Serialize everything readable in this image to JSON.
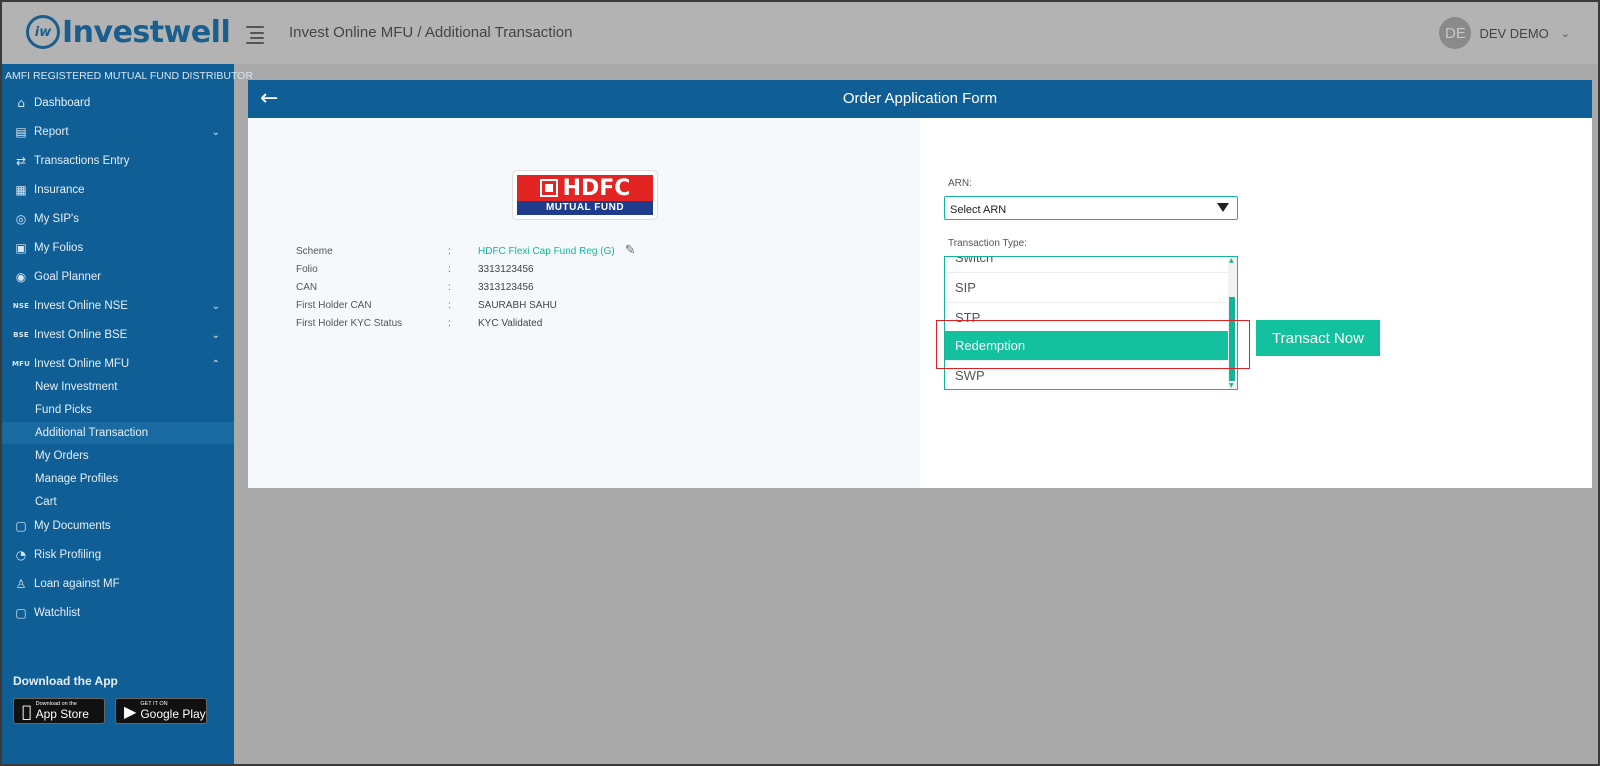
{
  "header": {
    "logo_mark": "iw",
    "logo_text": "Investwell",
    "breadcrumb": "Invest Online MFU / Additional Transaction",
    "user": {
      "initials": "DE",
      "name": "DEV DEMO"
    }
  },
  "sidebar": {
    "heading": "AMFI REGISTERED MUTUAL FUND DISTRIBUTOR",
    "items": [
      {
        "label": "Dashboard",
        "icon": "⌂"
      },
      {
        "label": "Report",
        "icon": "▤"
      },
      {
        "label": "Transactions Entry",
        "icon": "⇄"
      },
      {
        "label": "Insurance",
        "icon": "▦"
      },
      {
        "label": "My SIP's",
        "icon": "◎"
      },
      {
        "label": "My Folios",
        "icon": "▣"
      },
      {
        "label": "Goal Planner",
        "icon": "◉"
      },
      {
        "label": "Invest Online NSE",
        "icon": "NSE"
      },
      {
        "label": "Invest Online BSE",
        "icon": "BSE"
      },
      {
        "label": "Invest Online MFU",
        "icon": "MFU"
      }
    ],
    "sub_items": [
      {
        "label": "New Investment"
      },
      {
        "label": "Fund Picks"
      },
      {
        "label": "Additional Transaction"
      },
      {
        "label": "My Orders"
      },
      {
        "label": "Manage Profiles"
      },
      {
        "label": "Cart"
      }
    ],
    "bottom_items": [
      {
        "label": "My Documents",
        "icon": "▢"
      },
      {
        "label": "Risk Profiling",
        "icon": "◔"
      },
      {
        "label": "Loan against MF",
        "icon": "♙"
      },
      {
        "label": "Watchlist",
        "icon": "▢"
      }
    ],
    "download_label": "Download the App",
    "app_store": {
      "small": "Download on the",
      "big": "App Store"
    },
    "google_play": {
      "small": "GET IT ON",
      "big": "Google Play"
    }
  },
  "form": {
    "title": "Order Application Form",
    "logo": {
      "brand": "HDFC",
      "sub": "MUTUAL FUND"
    },
    "details": [
      {
        "label": "Scheme",
        "value": "HDFC Flexi Cap Fund Reg (G)"
      },
      {
        "label": "Folio",
        "value": "3313123456"
      },
      {
        "label": "CAN",
        "value": "3313123456"
      },
      {
        "label": "First Holder CAN",
        "value": "SAURABH SAHU"
      },
      {
        "label": "First Holder KYC Status",
        "value": "KYC Validated"
      }
    ],
    "arn_label": "ARN:",
    "arn_value": "Select ARN",
    "tx_type_label": "Transaction Type:",
    "tx_options": [
      "Switch",
      "SIP",
      "STP",
      "Redemption",
      "SWP"
    ],
    "selected_option": "Redemption",
    "transact_button": "Transact Now"
  }
}
